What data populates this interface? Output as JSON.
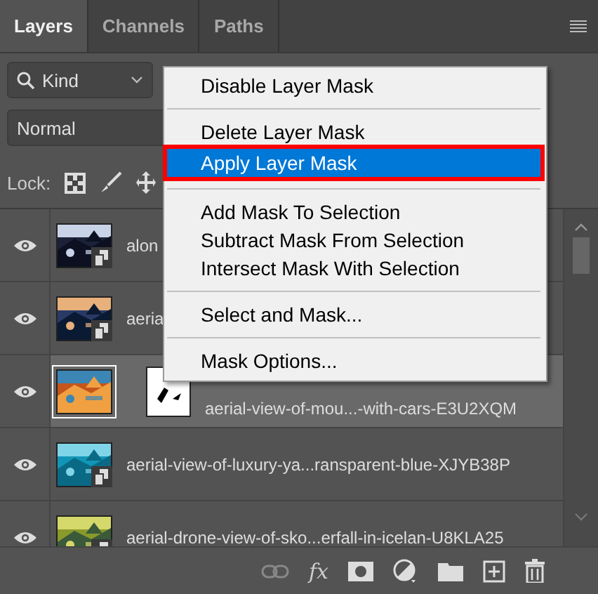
{
  "tabs": [
    {
      "label": "Layers",
      "selected": true
    },
    {
      "label": "Channels",
      "selected": false
    },
    {
      "label": "Paths",
      "selected": false
    }
  ],
  "filter": {
    "value": "Kind"
  },
  "blend_mode": {
    "value": "Normal"
  },
  "lock": {
    "label": "Lock:"
  },
  "layers": [
    {
      "name": "alon",
      "visible": true,
      "selected": false,
      "has_mask": false
    },
    {
      "name": "aeria",
      "visible": true,
      "selected": false,
      "has_mask": false
    },
    {
      "name": "aerial-view-of-mou...-with-cars-E3U2XQM",
      "visible": true,
      "selected": true,
      "has_mask": true
    },
    {
      "name": "aerial-view-of-luxury-ya...ransparent-blue-XJYB38P",
      "visible": true,
      "selected": false,
      "has_mask": false
    },
    {
      "name": "aerial-drone-view-of-sko...erfall-in-icelan-U8KLA25",
      "visible": true,
      "selected": false,
      "has_mask": false
    }
  ],
  "footer": {
    "fx_label": "fx"
  },
  "context_menu": {
    "items": [
      {
        "kind": "item",
        "label": "Disable Layer Mask",
        "selected": false
      },
      {
        "kind": "separator"
      },
      {
        "kind": "item",
        "label": "Delete Layer Mask",
        "selected": false
      },
      {
        "kind": "item",
        "label": "Apply Layer Mask",
        "selected": true
      },
      {
        "kind": "separator"
      },
      {
        "kind": "item",
        "label": "Add Mask To Selection",
        "selected": false
      },
      {
        "kind": "item",
        "label": "Subtract Mask From Selection",
        "selected": false
      },
      {
        "kind": "item",
        "label": "Intersect Mask With Selection",
        "selected": false
      },
      {
        "kind": "separator"
      },
      {
        "kind": "item",
        "label": "Select and Mask...",
        "selected": false
      },
      {
        "kind": "separator"
      },
      {
        "kind": "item",
        "label": "Mask Options...",
        "selected": false
      }
    ]
  }
}
